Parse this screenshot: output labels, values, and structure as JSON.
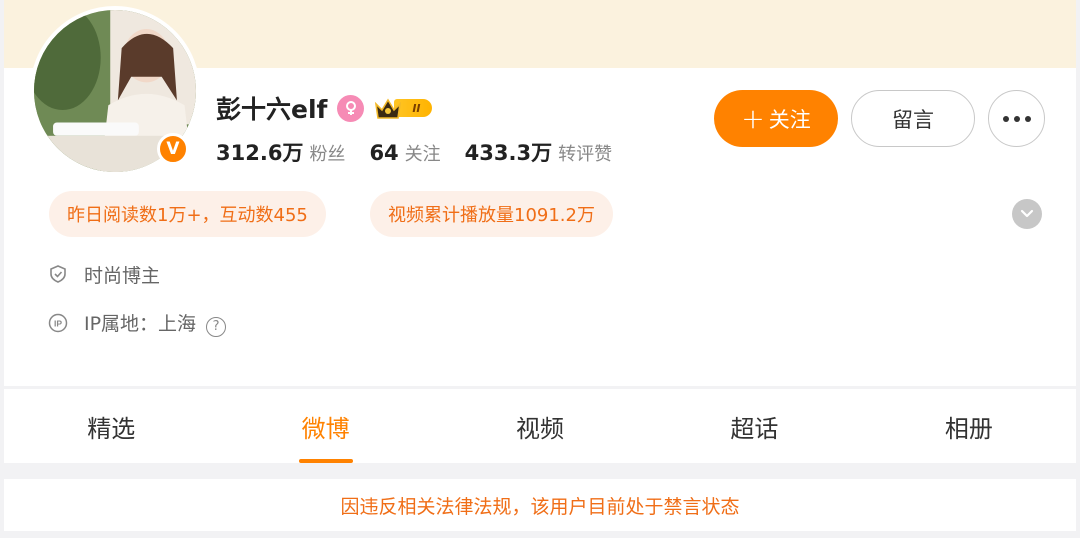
{
  "profile": {
    "username": "彭十六elf",
    "verified_icon": "V",
    "level_label": "II",
    "stats": [
      {
        "value": "312.6万",
        "label": "粉丝"
      },
      {
        "value": "64",
        "label": "关注"
      },
      {
        "value": "433.3万",
        "label": "转评赞"
      }
    ]
  },
  "actions": {
    "follow_label": "关注",
    "follow_icon": "+",
    "message_label": "留言",
    "more_icon": "more-dots-icon"
  },
  "chips": [
    {
      "text": "昨日阅读数1万+，互动数455"
    },
    {
      "text": "视频累计播放量1091.2万"
    }
  ],
  "info": {
    "category": "时尚博主",
    "ip_location": "IP属地：上海",
    "help_icon": "?"
  },
  "tabs": [
    {
      "label": "精选",
      "active": false
    },
    {
      "label": "微博",
      "active": true
    },
    {
      "label": "视频",
      "active": false
    },
    {
      "label": "超话",
      "active": false
    },
    {
      "label": "相册",
      "active": false
    }
  ],
  "notice": "因违反相关法律法规，该用户目前处于禁言状态",
  "colors": {
    "accent": "#ff8200",
    "chip_text": "#f06e17",
    "chip_bg": "#fdf0e8",
    "cover_bg": "#fbf2de",
    "female_badge": "#f68bb5"
  }
}
